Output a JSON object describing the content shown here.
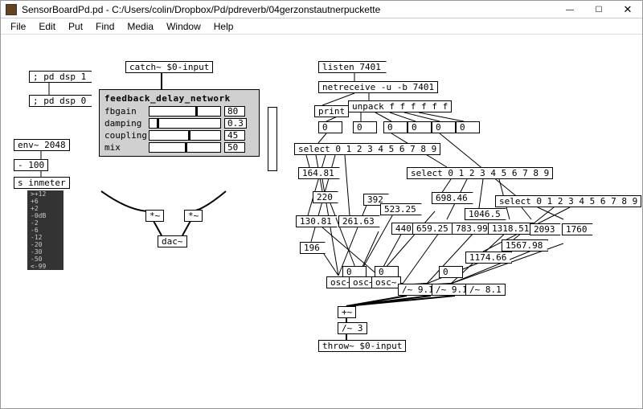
{
  "window": {
    "app_icon": "pd",
    "title": "SensorBoardPd.pd  - C:/Users/colin/Dropbox/Pd/pdreverb/04gerzonstautnerpuckette",
    "minimize": "—",
    "maximize": "☐",
    "close": "✕"
  },
  "menu": [
    "File",
    "Edit",
    "Put",
    "Find",
    "Media",
    "Window",
    "Help"
  ],
  "left": {
    "pd_dsp_on": "pd dsp 1",
    "pd_dsp_off": "pd dsp 0",
    "env": "env~ 2048",
    "env_num": "- 100",
    "s_inmeter": "s inmeter",
    "vu_scale": [
      ">+12",
      "+6",
      "+2",
      "-0dB",
      "-2",
      "-6",
      "-12",
      "-20",
      "-30",
      "-50",
      "<-99"
    ]
  },
  "catch": "catch~ $0-input",
  "sub": {
    "title": "feedback_delay_network",
    "rows": [
      {
        "label": "fbgain",
        "value": "80",
        "pos": 65
      },
      {
        "label": "damping",
        "value": "0.3",
        "pos": 10
      },
      {
        "label": "coupling",
        "value": "45",
        "pos": 55
      },
      {
        "label": "mix",
        "value": "50",
        "pos": 50
      }
    ]
  },
  "mix": {
    "mul1": "*~",
    "mul2": "*~",
    "dac": "dac~"
  },
  "listen": "listen 7401",
  "netreceive": "netreceive -u -b 7401",
  "print": "print",
  "unpack": "unpack f f f f f f",
  "zero": "0",
  "select_a": "select 0 1 2 3 4 5 6 7 8 9",
  "select_b": "select 0 1 2 3 4 5 6 7 8 9",
  "select_c": "select 0 1 2 3 4 5 6 7 8 9",
  "msgvals": {
    "a": "164.81",
    "b": "220",
    "c": "130.81",
    "d": "196",
    "e": "261.63",
    "f": "392",
    "g": "523.25",
    "h": "440",
    "i": "659.25",
    "j": "698.46",
    "k": "783.99",
    "l": "1046.5",
    "m": "1318.51",
    "n": "1174.66",
    "o": "1567.98",
    "p": "2093",
    "q": "1760"
  },
  "osc1": "osc~",
  "osc2": "osc~",
  "osc3": "osc~",
  "div1": "/~ 9.1",
  "div2": "/~ 9.1",
  "div3": "/~ 8.1",
  "add": "+~",
  "divfinal": "/~ 3",
  "throw": "throw~ $0-input"
}
